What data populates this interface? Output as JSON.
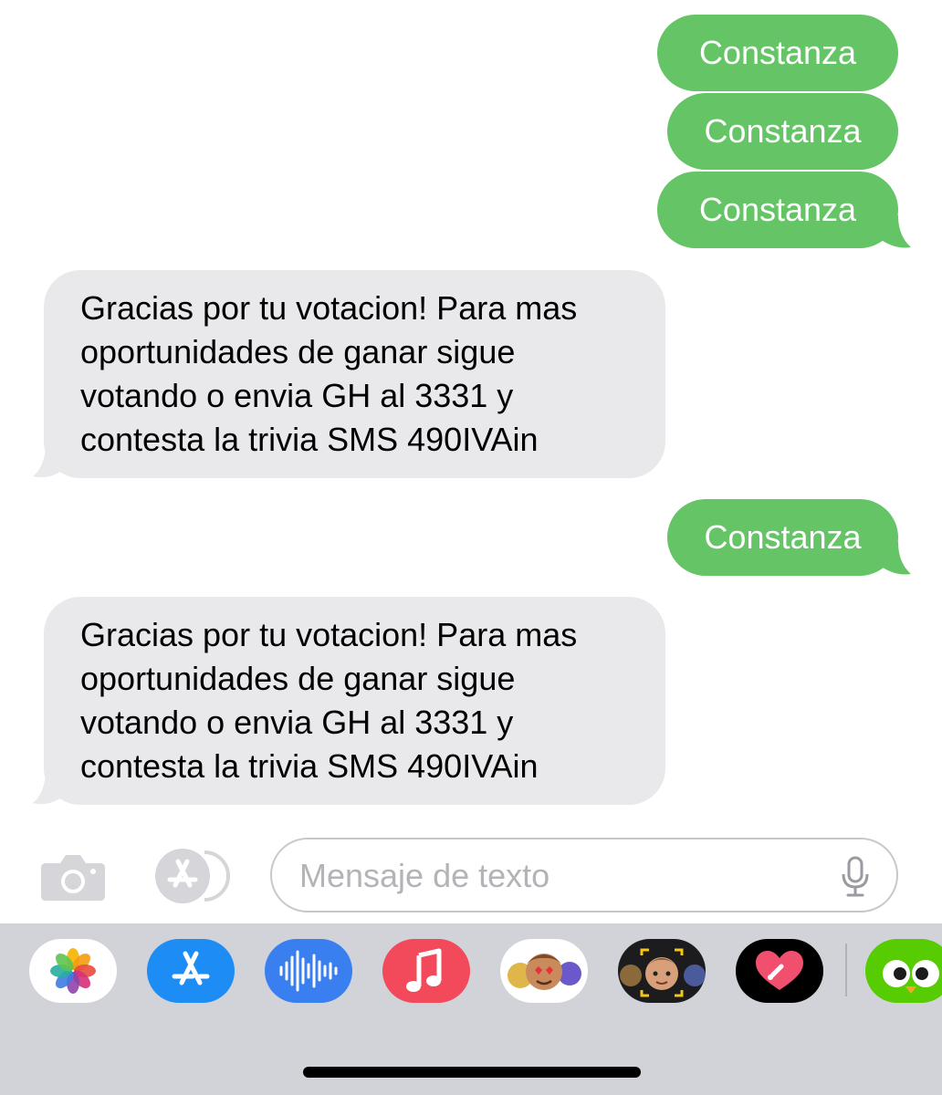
{
  "thread": {
    "messages": [
      {
        "direction": "sent",
        "text": "Constanza"
      },
      {
        "direction": "sent",
        "text": "Constanza"
      },
      {
        "direction": "sent",
        "text": "Constanza"
      },
      {
        "direction": "received",
        "text": "Gracias por tu votacion! Para mas\noportunidades de ganar sigue\nvotando o envia GH al 3331 y\ncontesta la trivia SMS 490IVAin"
      },
      {
        "direction": "sent",
        "text": "Constanza"
      },
      {
        "direction": "received",
        "text": "Gracias por tu votacion! Para mas\noportunidades de ganar sigue\nvotando o envia GH al 3331 y\ncontesta la trivia SMS 490IVAin"
      }
    ]
  },
  "composer": {
    "placeholder": "Mensaje de texto",
    "camera_icon": "camera-icon",
    "apps_icon": "app-store-icon",
    "mic_icon": "microphone-icon"
  },
  "app_drawer": {
    "apps": [
      {
        "name": "Photos",
        "icon": "photos-icon"
      },
      {
        "name": "App Store",
        "icon": "app-store-icon"
      },
      {
        "name": "Audio Message",
        "icon": "audio-waveform-icon"
      },
      {
        "name": "Music",
        "icon": "music-note-icon"
      },
      {
        "name": "Memoji Stickers",
        "icon": "memoji-stickers-icon"
      },
      {
        "name": "Memoji",
        "icon": "memoji-icon"
      },
      {
        "name": "Digital Touch",
        "icon": "digital-touch-heart-icon"
      },
      {
        "name": "Duolingo",
        "icon": "duolingo-owl-icon"
      }
    ]
  },
  "colors": {
    "sent_bubble": "#65c466",
    "received_bubble": "#e9e9eb",
    "drawer_background": "#d1d3d9"
  }
}
